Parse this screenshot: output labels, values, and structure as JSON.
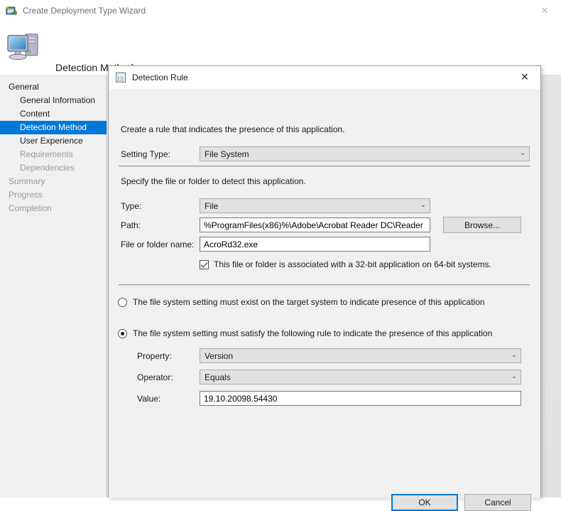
{
  "wizard": {
    "title": "Create Deployment Type Wizard",
    "title_icon": "deployment-wizard-icon",
    "close_label": "✕",
    "header_title": "Detection Method",
    "header_icon": "computer-monitor-icon",
    "nav": [
      {
        "label": "General",
        "level": 0,
        "state": "normal"
      },
      {
        "label": "General Information",
        "level": 1,
        "state": "normal"
      },
      {
        "label": "Content",
        "level": 1,
        "state": "normal"
      },
      {
        "label": "Detection Method",
        "level": 1,
        "state": "selected"
      },
      {
        "label": "User Experience",
        "level": 1,
        "state": "normal"
      },
      {
        "label": "Requirements",
        "level": 1,
        "state": "disabled"
      },
      {
        "label": "Dependencies",
        "level": 1,
        "state": "disabled"
      },
      {
        "label": "Summary",
        "level": 0,
        "state": "disabled"
      },
      {
        "label": "Progress",
        "level": 0,
        "state": "disabled"
      },
      {
        "label": "Completion",
        "level": 0,
        "state": "disabled"
      }
    ]
  },
  "dialog": {
    "title": "Detection Rule",
    "title_icon": "detection-rule-icon",
    "close_label": "✕",
    "intro": "Create a rule that indicates the presence of this application.",
    "setting_type": {
      "label": "Setting Type:",
      "value": "File System",
      "chevron": "⌄"
    },
    "specify_text": "Specify the file or folder to detect this application.",
    "type": {
      "label": "Type:",
      "value": "File",
      "chevron": "⌄"
    },
    "path": {
      "label": "Path:",
      "value": "%ProgramFiles(x86)%\\Adobe\\Acrobat Reader DC\\Reader"
    },
    "browse_label": "Browse...",
    "file_name": {
      "label": "File or folder name:",
      "value": "AcroRd32.exe"
    },
    "assoc_32bit": {
      "label": "This file or folder is associated with a 32-bit application on 64-bit systems.",
      "checked": true
    },
    "rule_mode": {
      "exists": {
        "label": "The file system setting must exist on the target system to indicate presence of this application",
        "selected": false
      },
      "satisfy": {
        "label": "The file system setting must satisfy the following rule to indicate the presence of this application",
        "selected": true
      }
    },
    "property": {
      "label": "Property:",
      "value": "Version",
      "chevron": "⌄"
    },
    "operator": {
      "label": "Operator:",
      "value": "Equals",
      "chevron": "⌄"
    },
    "value": {
      "label": "Value:",
      "value": "19.10.20098.54430"
    },
    "ok_label": "OK",
    "cancel_label": "Cancel"
  },
  "colors": {
    "accent": "#0078d7",
    "dialog_bg": "#f0f0f0",
    "disabled_text": "#9a9a9a"
  }
}
